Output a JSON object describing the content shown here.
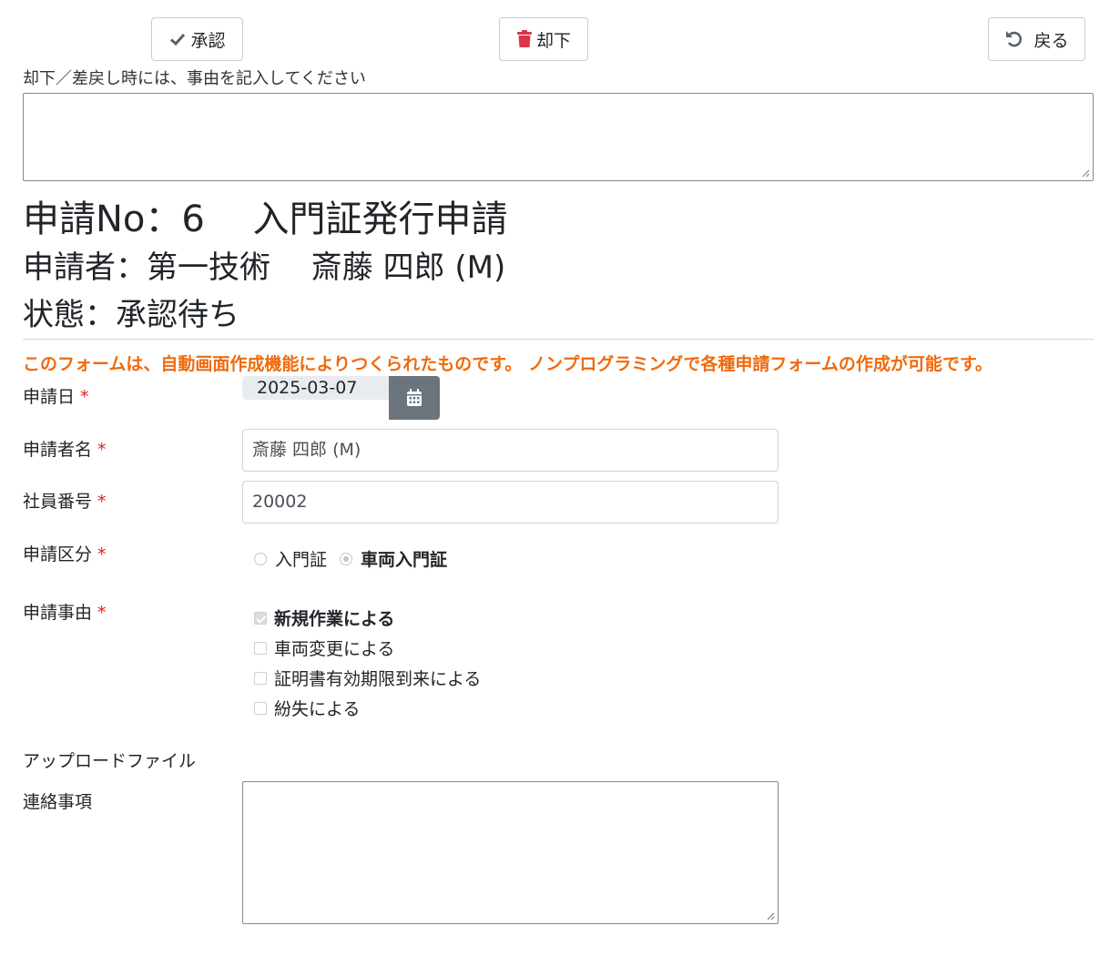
{
  "toolbar": {
    "approve_label": "承認",
    "reject_label": "却下",
    "back_label": "戻る"
  },
  "reason": {
    "label": "却下／差戻し時には、事由を記入してください",
    "value": ""
  },
  "header": {
    "application_line": "申請No：6　 入門証発行申請",
    "applicant_line": "申請者：第一技術　 斎藤 四郎 (M)",
    "status_line": "状態：承認待ち"
  },
  "notice": "このフォームは、自動画面作成機能によりつくられたものです。 ノンプログラミングで各種申請フォームの作成が可能です。",
  "form": {
    "required_mark": "*",
    "date": {
      "label": "申請日",
      "value": "2025-03-07"
    },
    "applicant_name": {
      "label": "申請者名",
      "value": "斎藤 四郎 (M)"
    },
    "employee_no": {
      "label": "社員番号",
      "value": "20002"
    },
    "category": {
      "label": "申請区分",
      "options": [
        {
          "label": "入門証",
          "selected": false
        },
        {
          "label": "車両入門証",
          "selected": true
        }
      ]
    },
    "reason": {
      "label": "申請事由",
      "options": [
        {
          "label": "新規作業による",
          "checked": true
        },
        {
          "label": "車両変更による",
          "checked": false
        },
        {
          "label": "証明書有効期限到来による",
          "checked": false
        },
        {
          "label": "紛失による",
          "checked": false
        }
      ]
    },
    "upload": {
      "label": "アップロードファイル"
    },
    "contact": {
      "label": "連絡事項",
      "value": ""
    }
  },
  "colors": {
    "notice": "#f06a0c",
    "required": "#e02020",
    "reject_icon": "#dc3545",
    "calendar_button": "#6c757d"
  },
  "icons": {
    "approve": "check-icon",
    "reject": "trash-icon",
    "back": "undo-icon",
    "date": "calendar-icon"
  }
}
